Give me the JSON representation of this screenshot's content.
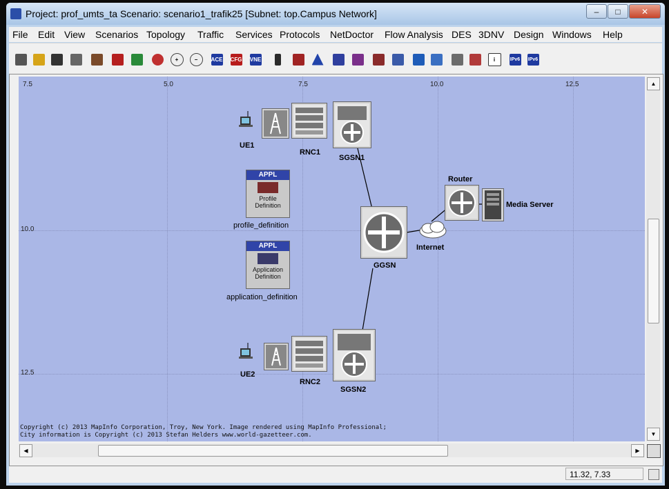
{
  "window": {
    "title": "Project: prof_umts_ta Scenario: scenario1_trafik25  [Subnet: top.Campus Network]",
    "controls": [
      "–",
      "□",
      "✕"
    ]
  },
  "menu": [
    "File",
    "Edit",
    "View",
    "Scenarios",
    "Topology",
    "Traffic",
    "Services",
    "Protocols",
    "NetDoctor",
    "Flow Analysis",
    "DES",
    "3DNV",
    "Design",
    "Windows",
    "Help"
  ],
  "toolbar": {
    "button_labels": [
      "ACE",
      "CFG",
      "VNE",
      "IPv6"
    ]
  },
  "canvas": {
    "x_ticks": [
      "7.5",
      "5.0",
      "7.5",
      "10.0",
      "12.5"
    ],
    "y_ticks": [
      "10.0",
      "12.5"
    ],
    "nodes": {
      "ue1": "UE1",
      "rnc1": "RNC1",
      "sgsn1": "SGSN1",
      "ggsn": "GGSN",
      "internet": "Internet",
      "router": "Router",
      "media_server": "Media Server",
      "ue2": "UE2",
      "rnc2": "RNC2",
      "sgsn2": "SGSN2"
    },
    "profile_def": {
      "header": "APPL",
      "body_line1": "Profile",
      "body_line2": "Definition",
      "caption": "profile_definition"
    },
    "application_def": {
      "header": "APPL",
      "body_line1": "Application",
      "body_line2": "Definition",
      "caption": "application_definition"
    },
    "copyright_line1": "Copyright (c) 2013 MapInfo Corporation, Troy, New York. Image rendered using MapInfo Professional;",
    "copyright_line2": "City information is Copyright (c) 2013 Stefan Helders www.world-gazetteer.com."
  },
  "status": {
    "coords": "11.32, 7.33"
  },
  "colors": {
    "canvas_bg": "#aab7e6",
    "appl_header": "#3044a8"
  }
}
